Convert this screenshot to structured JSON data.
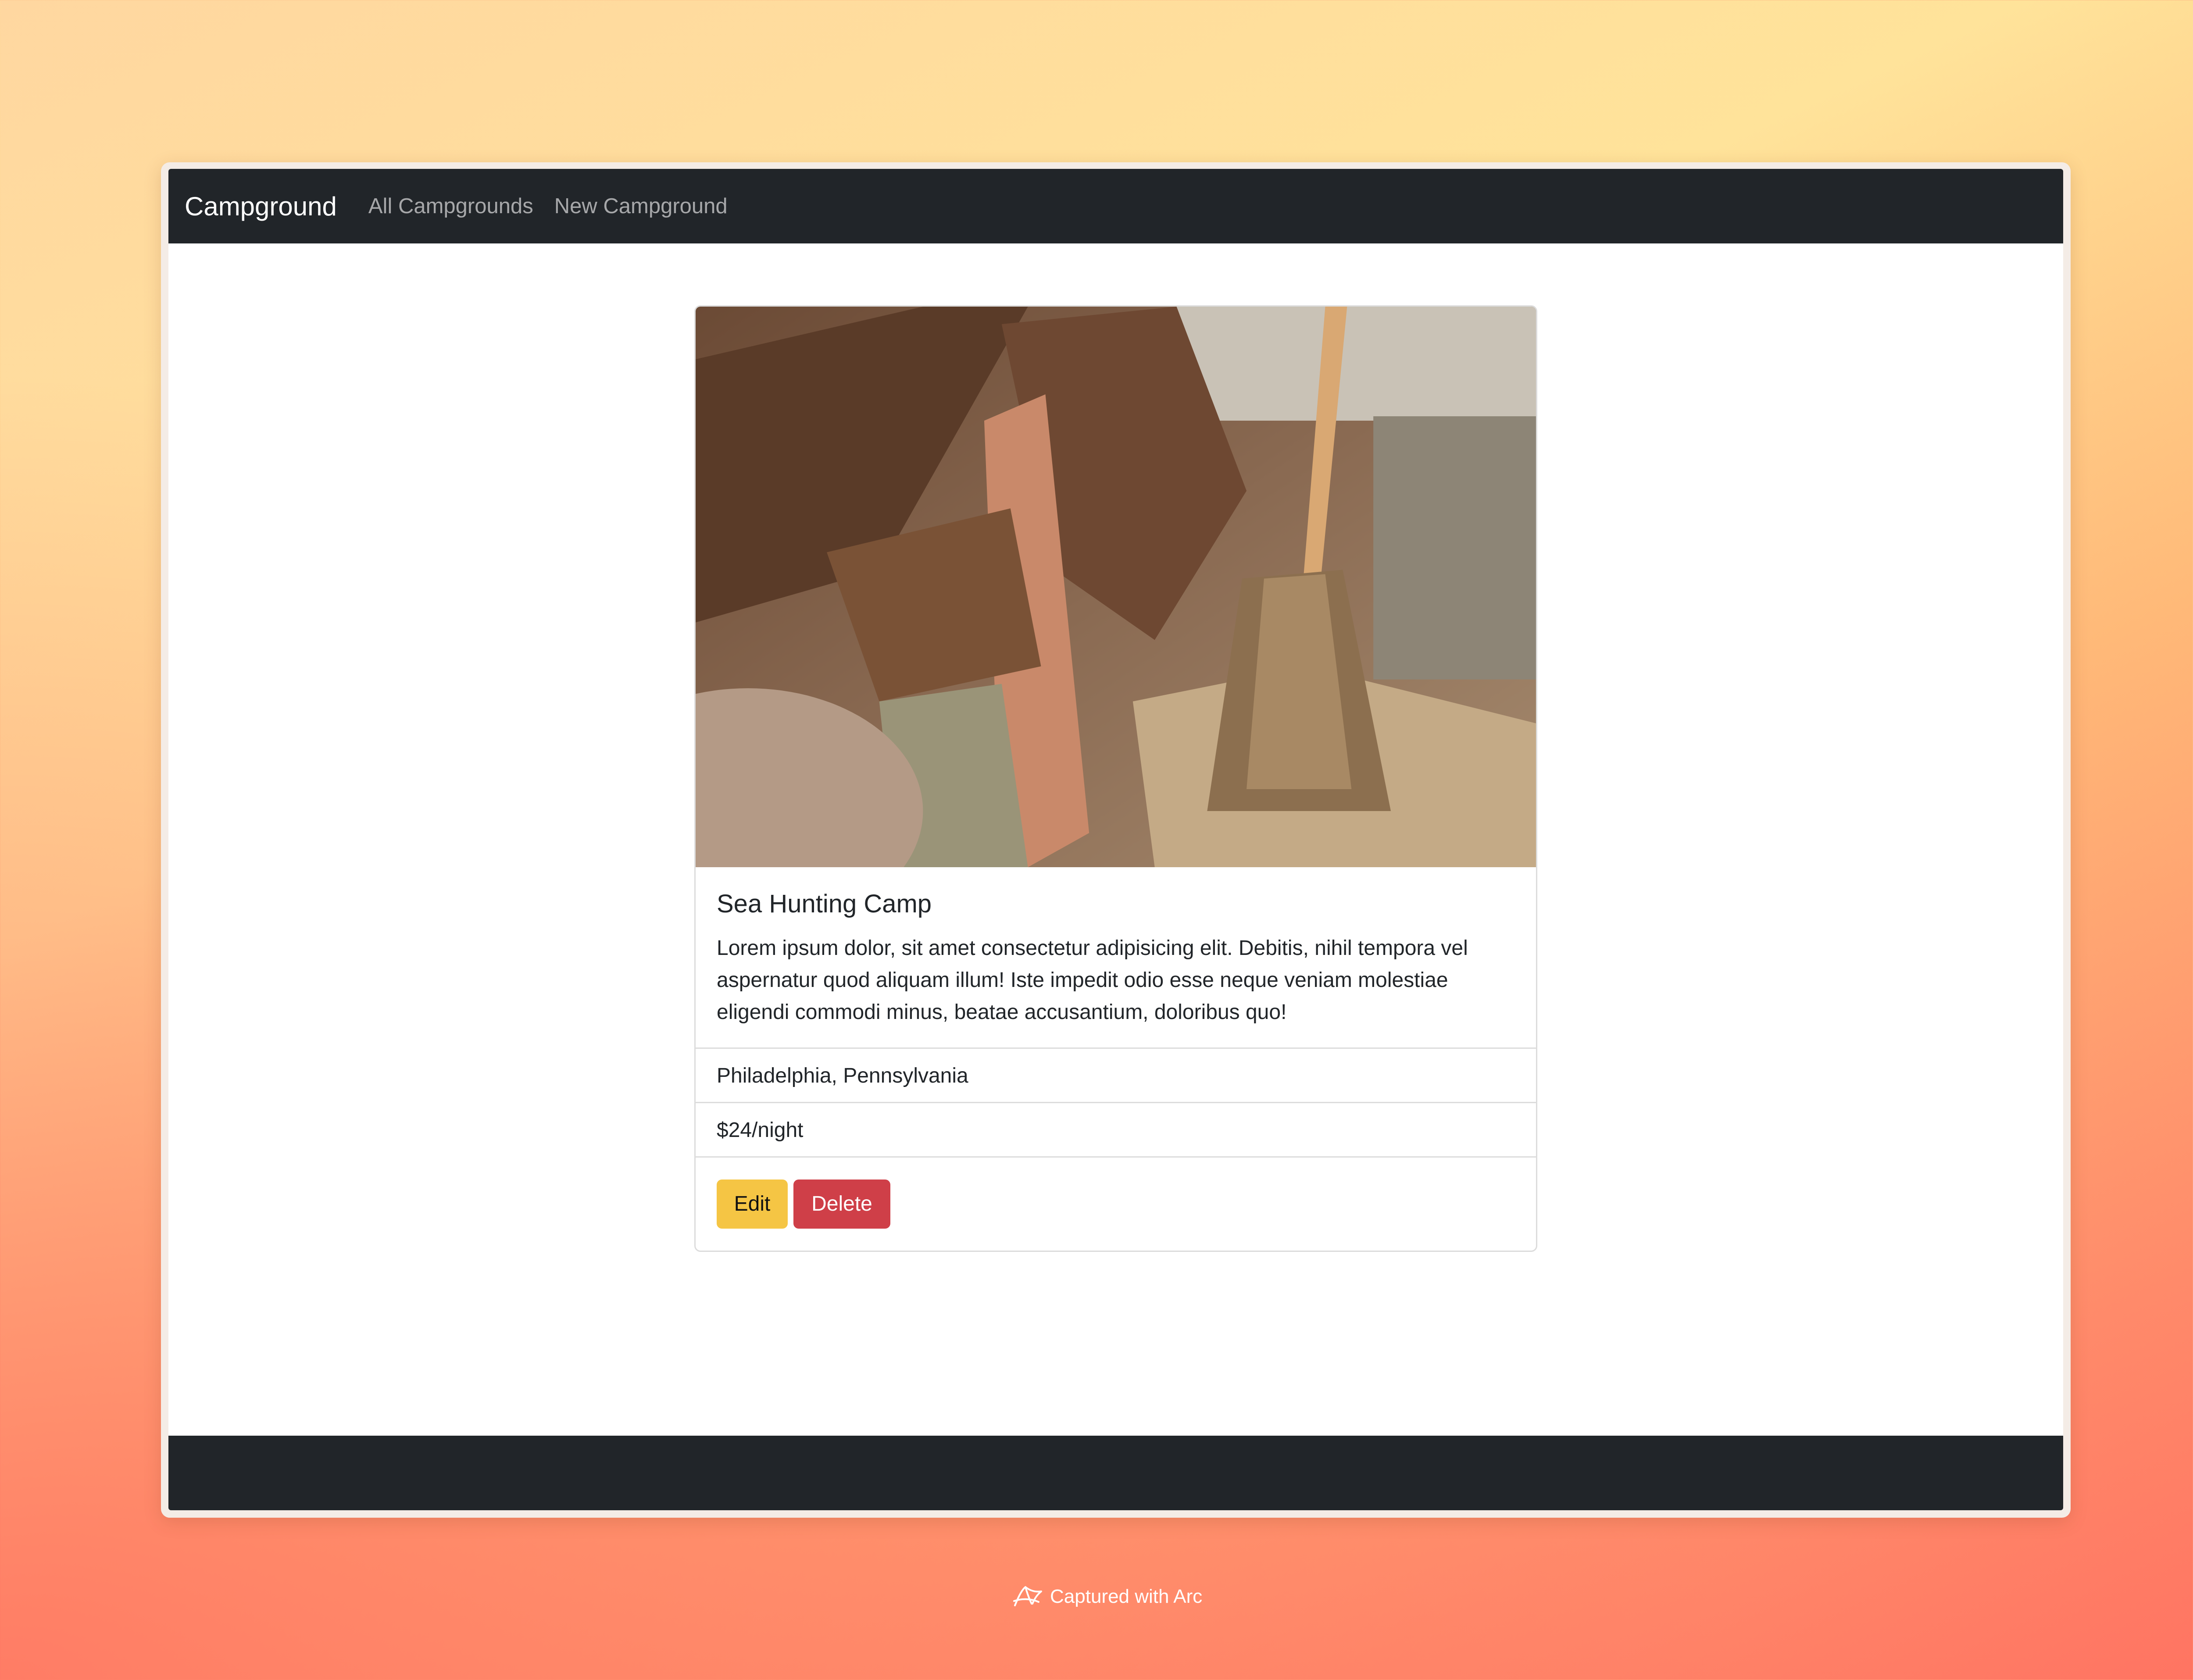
{
  "navbar": {
    "brand": "Campground",
    "links": [
      "All Campgrounds",
      "New Campground"
    ]
  },
  "campground": {
    "title": "Sea Hunting Camp",
    "description": "Lorem ipsum dolor, sit amet consectetur adipisicing elit. Debitis, nihil tempora vel aspernatur quod aliquam illum! Iste impedit odio esse neque veniam molestiae eligendi commodi minus, beataе accusantium, doloribus quo!",
    "location": "Philadelphia, Pennsylvania",
    "price": "$24/night",
    "image_icon": "campground-photo-icon"
  },
  "actions": {
    "edit_label": "Edit",
    "delete_label": "Delete"
  },
  "watermark": {
    "text": "Captured with Arc",
    "icon": "arc-logo-icon"
  },
  "colors": {
    "navbar": "#212529",
    "edit_button": "#f5c544",
    "delete_button": "#cf3f48"
  }
}
